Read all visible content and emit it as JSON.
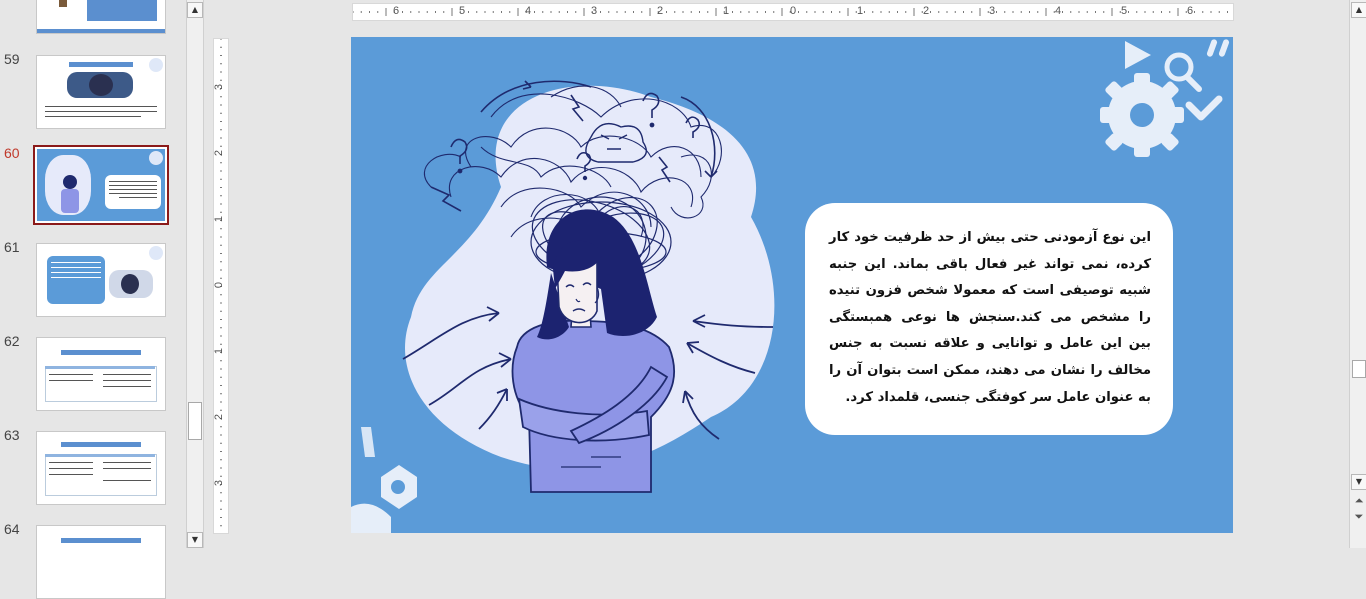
{
  "thumbnails": {
    "numbers": [
      "59",
      "60",
      "61",
      "62",
      "63",
      "64"
    ],
    "active": "60"
  },
  "ruler": {
    "horizontal_labels": [
      "6",
      "5",
      "4",
      "3",
      "2",
      "1",
      "0",
      "1",
      "2",
      "3",
      "4",
      "5",
      "6"
    ],
    "vertical_labels": [
      "3",
      "2",
      "1",
      "0",
      "1",
      "2",
      "3"
    ]
  },
  "slide": {
    "body_text": "این نوع آزمودنی حتی بیش از حد ظرفیت خود کار کرده، نمی تواند غیر فعال باقی بماند. این جنبه شبیه توصیفی است که معمولا شخص فزون تنیده را مشخص می کند.سنجش ها نوعی همبستگی بین این عامل و توانایی و علاقه نسبت به جنس مخالف را نشان می دهند، ممکن است بتوان آن را به عنوان عامل سر کوفتگی جنسی، قلمداد کرد.",
    "colors": {
      "background": "#5b9bd8",
      "blob": "#e6eafa",
      "ink": "#1f2a6e",
      "sweater": "#8e95e6"
    }
  },
  "icons": [
    "gear-icon",
    "play-icon",
    "magnifier-icon",
    "checkmark-icon",
    "scroll-up-icon",
    "scroll-down-icon",
    "prev-slide-icon",
    "next-slide-icon"
  ]
}
